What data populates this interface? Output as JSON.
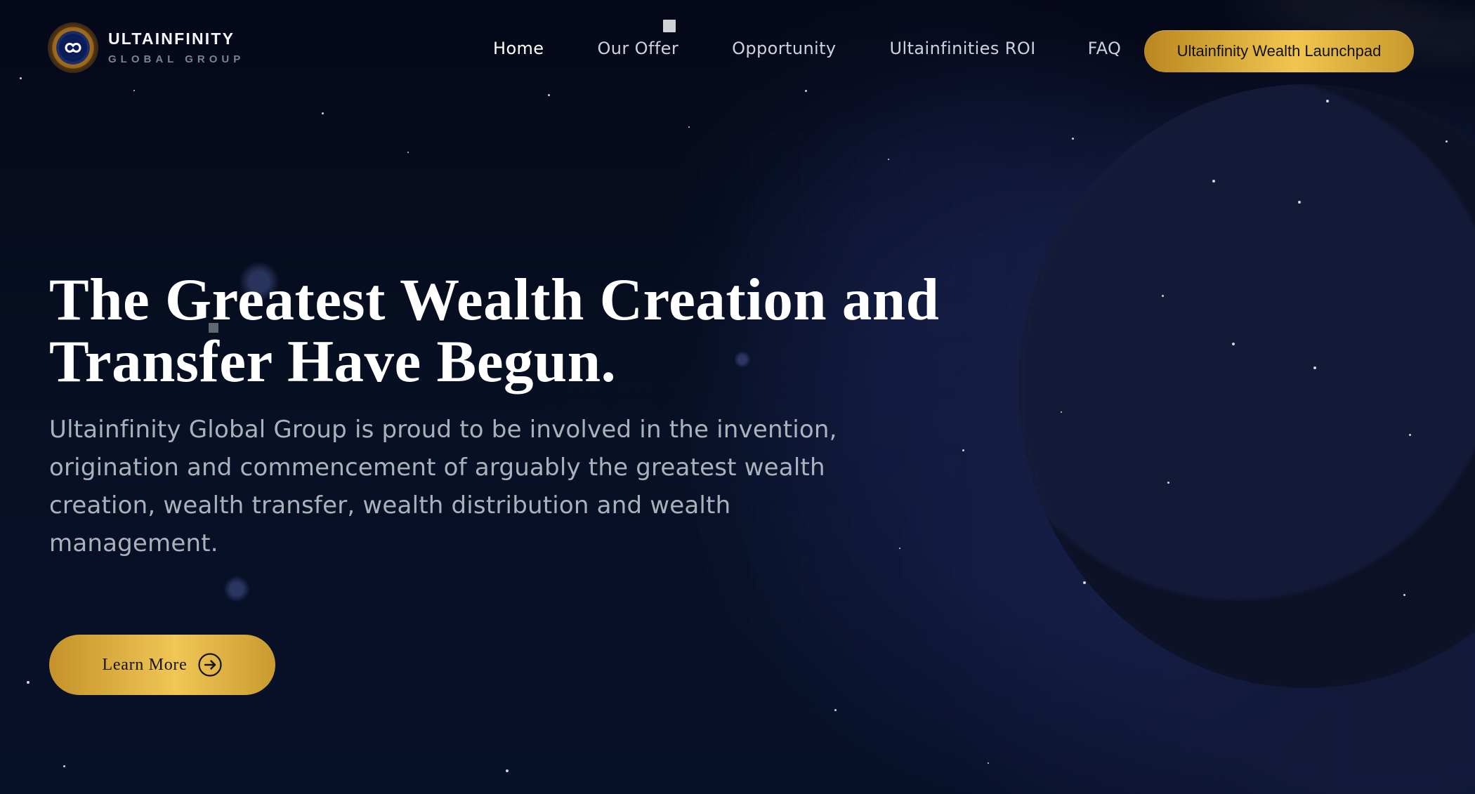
{
  "header": {
    "logo": {
      "title": "ULTAINFINITY",
      "subtitle": "GLOBAL GROUP",
      "icon": "infinity-icon"
    },
    "nav": [
      {
        "label": "Home"
      },
      {
        "label": "Our Offer"
      },
      {
        "label": "Opportunity"
      },
      {
        "label": "Ultainfinities ROI"
      },
      {
        "label": "FAQ"
      }
    ],
    "cta_label": "Ultainfinity Wealth Launchpad"
  },
  "hero": {
    "title_lines": [
      "The Greatest Wealth Creation and",
      "Transfer Have Begun."
    ],
    "description": "Ultainfinity Global Group is proud to be involved in the invention, origination and commencement of arguably the greatest wealth creation, wealth transfer, wealth distribution and wealth management.",
    "button_label": "Learn More",
    "button_icon": "arrow-right-circle-icon"
  },
  "colors": {
    "background": "#070b1e",
    "gold_light": "#f0c656",
    "gold_dark": "#b98721",
    "text_primary": "#ffffff",
    "text_secondary": "#dbdee6"
  }
}
